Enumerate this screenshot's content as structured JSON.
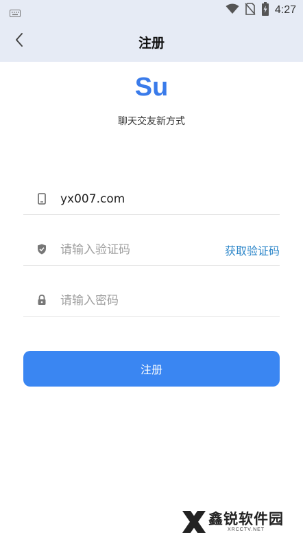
{
  "status_bar": {
    "time": "4:27",
    "icons": [
      "keyboard-icon",
      "wifi-icon",
      "no-sim-icon",
      "battery-charging-icon"
    ]
  },
  "nav": {
    "back_icon": "chevron-left-icon",
    "title": "注册"
  },
  "brand": {
    "logo_text": "Su",
    "slogan": "聊天交友新方式",
    "accent_color": "#3a7bea"
  },
  "form": {
    "phone": {
      "icon": "phone-icon",
      "value": "yx007.com",
      "placeholder": ""
    },
    "code": {
      "icon": "shield-icon",
      "value": "",
      "placeholder": "请输入验证码",
      "get_code_label": "获取验证码"
    },
    "password": {
      "icon": "lock-icon",
      "value": "",
      "placeholder": "请输入密码"
    },
    "submit_label": "注册",
    "button_color": "#3a86f2"
  },
  "watermark": {
    "text": "鑫锐软件园",
    "sub": "XRCCTV.NET"
  }
}
